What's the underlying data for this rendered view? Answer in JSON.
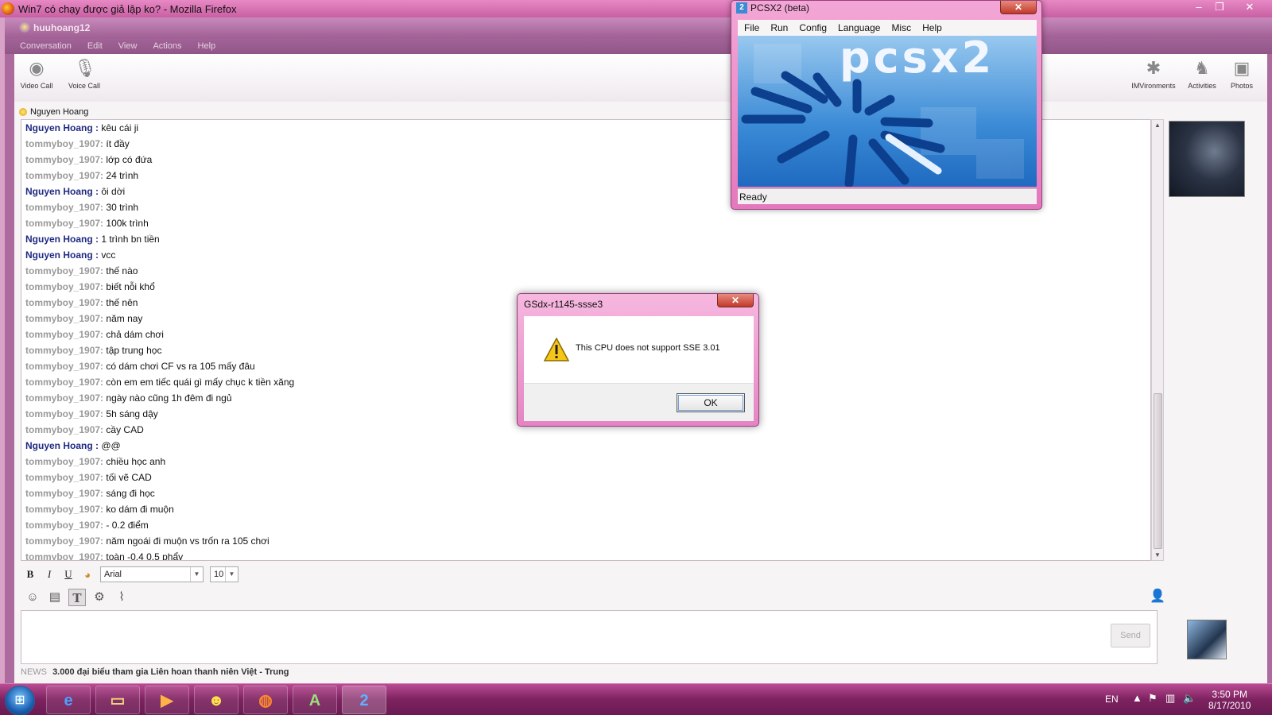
{
  "firefox": {
    "title": "Win7 có chạy được giả lập ko? - Mozilla Firefox"
  },
  "ym": {
    "title": "huuhoang12",
    "menu": [
      "Conversation",
      "Edit",
      "View",
      "Actions",
      "Help"
    ],
    "toolbar": {
      "video_call": "Video Call",
      "voice_call": "Voice Call",
      "imvironments": "IMVironments",
      "activities": "Activities",
      "photos": "Photos"
    },
    "contact": "Nguyen Hoang",
    "messages": [
      {
        "sender": "Nguyen Hoang :",
        "text": "kêu cái ji",
        "who": "nh"
      },
      {
        "sender": "tommyboy_1907:",
        "text": "ít đầy",
        "who": "tb"
      },
      {
        "sender": "tommyboy_1907:",
        "text": "lớp có đứa",
        "who": "tb"
      },
      {
        "sender": "tommyboy_1907:",
        "text": "24 trình",
        "who": "tb"
      },
      {
        "sender": "Nguyen Hoang :",
        "text": "ôi dời",
        "who": "nh"
      },
      {
        "sender": "tommyboy_1907:",
        "text": "30 trình",
        "who": "tb"
      },
      {
        "sender": "tommyboy_1907:",
        "text": "100k trình",
        "who": "tb"
      },
      {
        "sender": "Nguyen Hoang :",
        "text": "1 trình bn tiền",
        "who": "nh"
      },
      {
        "sender": "Nguyen Hoang :",
        "text": "vcc",
        "who": "nh"
      },
      {
        "sender": "tommyboy_1907:",
        "text": "thế nào",
        "who": "tb"
      },
      {
        "sender": "tommyboy_1907:",
        "text": "biết nỗi khổ",
        "who": "tb"
      },
      {
        "sender": "tommyboy_1907:",
        "text": "thế nên",
        "who": "tb"
      },
      {
        "sender": "tommyboy_1907:",
        "text": "năm nay",
        "who": "tb"
      },
      {
        "sender": "tommyboy_1907:",
        "text": "chả dám chơi",
        "who": "tb"
      },
      {
        "sender": "tommyboy_1907:",
        "text": "tập trung học",
        "who": "tb"
      },
      {
        "sender": "tommyboy_1907:",
        "text": "có dám chơi CF vs ra 105 mấy đâu",
        "who": "tb"
      },
      {
        "sender": "tommyboy_1907:",
        "text": "còn em em tiếc quái gì mấy chục k tiền xăng",
        "who": "tb"
      },
      {
        "sender": "tommyboy_1907:",
        "text": "ngày nào cũng 1h đêm đi ngủ",
        "who": "tb"
      },
      {
        "sender": "tommyboy_1907:",
        "text": "5h sáng dậy",
        "who": "tb"
      },
      {
        "sender": "tommyboy_1907:",
        "text": "cầy CAD",
        "who": "tb"
      },
      {
        "sender": "Nguyen Hoang :",
        "text": "@@",
        "who": "nh"
      },
      {
        "sender": "tommyboy_1907:",
        "text": "chiều học anh",
        "who": "tb"
      },
      {
        "sender": "tommyboy_1907:",
        "text": "tối vẽ CAD",
        "who": "tb"
      },
      {
        "sender": "tommyboy_1907:",
        "text": "sáng đi học",
        "who": "tb"
      },
      {
        "sender": "tommyboy_1907:",
        "text": "ko dám đi muộn",
        "who": "tb"
      },
      {
        "sender": "tommyboy_1907:",
        "text": "- 0.2 điểm",
        "who": "tb"
      },
      {
        "sender": "tommyboy_1907:",
        "text": "năm ngoái đi muộn vs trốn ra 105 chơi",
        "who": "tb"
      },
      {
        "sender": "tommyboy_1907:",
        "text": "toàn -0.4 0.5 phẩy",
        "who": "tb"
      }
    ],
    "format": {
      "bold": "B",
      "italic": "I",
      "underline": "U",
      "font": "Arial",
      "size": "10"
    },
    "send_label": "Send",
    "news": {
      "tag": "NEWS",
      "headline": "3.000 đại biểu tham gia Liên hoan thanh niên Việt - Trung"
    }
  },
  "pcsx2": {
    "title": "PCSX2 (beta)",
    "menu": [
      "File",
      "Run",
      "Config",
      "Language",
      "Misc",
      "Help"
    ],
    "logo": "pcsx2",
    "status": "Ready"
  },
  "gsdx": {
    "title": "GSdx-r1145-ssse3",
    "message": "This CPU does not support SSE 3.01",
    "ok_label": "OK"
  },
  "taskbar": {
    "language": "EN",
    "time": "3:50 PM",
    "date": "8/17/2010"
  },
  "colors": {
    "theme_pink": "#e584c3",
    "sender_nguyen": "#1f2a80",
    "sender_tommy": "#9a9a9a"
  }
}
